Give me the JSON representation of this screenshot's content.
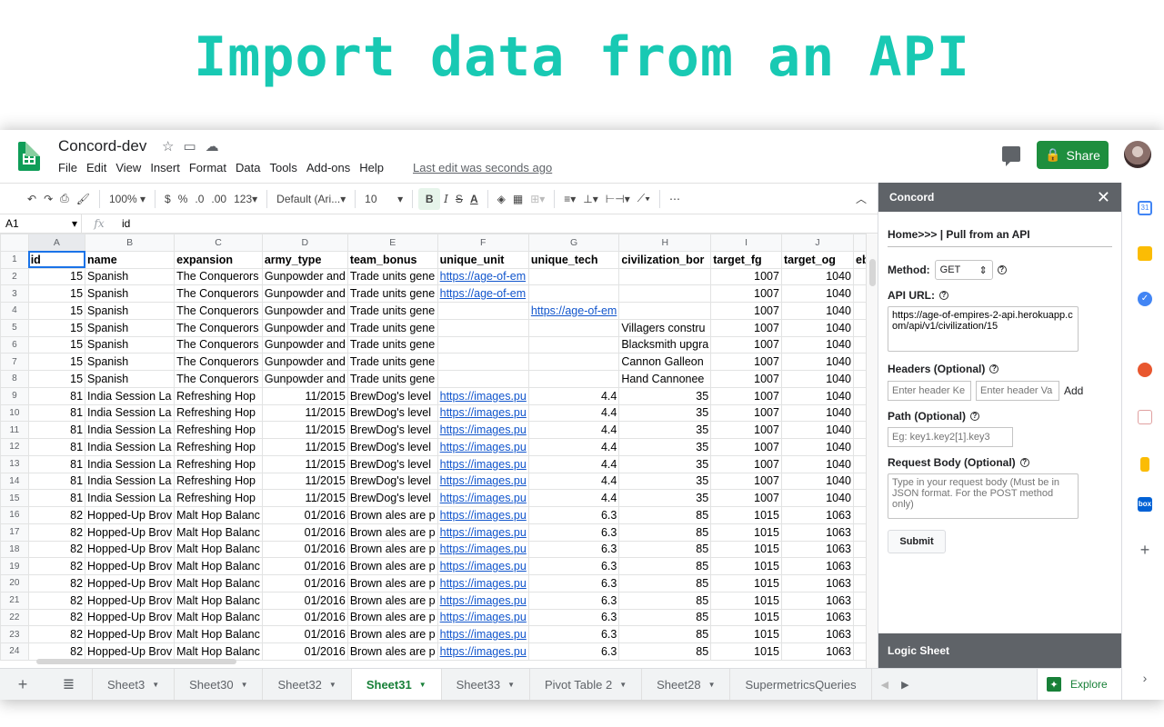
{
  "headline": "Import data from an API",
  "doc": {
    "title": "Concord-dev",
    "menu": [
      "File",
      "Edit",
      "View",
      "Insert",
      "Format",
      "Data",
      "Tools",
      "Add-ons",
      "Help"
    ],
    "last_edit": "Last edit was seconds ago",
    "share_label": "Share"
  },
  "toolbar": {
    "zoom": "100%",
    "currency": "$",
    "percent": "%",
    "dec_less": ".0",
    "dec_more": ".00",
    "more_formats": "123",
    "font": "Default (Ari...",
    "font_size": "10",
    "bold": "B",
    "italic": "I",
    "strike": "S",
    "text_color": "A"
  },
  "formula_bar": {
    "cell": "A1",
    "fx": "fx",
    "value": "id"
  },
  "grid": {
    "col_letters": [
      "A",
      "B",
      "C",
      "D",
      "E",
      "F",
      "G",
      "H",
      "I",
      "J",
      ""
    ],
    "row_numbers": [
      "1",
      "2",
      "3",
      "4",
      "5",
      "6",
      "7",
      "8",
      "9",
      "10",
      "11",
      "12",
      "13",
      "14",
      "15",
      "16",
      "17",
      "18",
      "19",
      "20",
      "21",
      "22",
      "23",
      "24"
    ],
    "header": [
      "id",
      "name",
      "expansion",
      "army_type",
      "team_bonus",
      "unique_unit",
      "unique_tech",
      "civilization_bor",
      "target_fg",
      "target_og",
      "eb"
    ],
    "rows": [
      [
        "15",
        "Spanish",
        "The Conquerors",
        "Gunpowder and",
        "Trade units gene",
        "https://age-of-em",
        "",
        "",
        "1007",
        "1040",
        ""
      ],
      [
        "15",
        "Spanish",
        "The Conquerors",
        "Gunpowder and",
        "Trade units gene",
        "https://age-of-em",
        "",
        "",
        "1007",
        "1040",
        ""
      ],
      [
        "15",
        "Spanish",
        "The Conquerors",
        "Gunpowder and",
        "Trade units gene",
        "",
        "https://age-of-em",
        "",
        "1007",
        "1040",
        ""
      ],
      [
        "15",
        "Spanish",
        "The Conquerors",
        "Gunpowder and",
        "Trade units gene",
        "",
        "",
        "Villagers constru",
        "1007",
        "1040",
        ""
      ],
      [
        "15",
        "Spanish",
        "The Conquerors",
        "Gunpowder and",
        "Trade units gene",
        "",
        "",
        "Blacksmith upgra",
        "1007",
        "1040",
        ""
      ],
      [
        "15",
        "Spanish",
        "The Conquerors",
        "Gunpowder and",
        "Trade units gene",
        "",
        "",
        "Cannon Galleon",
        "1007",
        "1040",
        ""
      ],
      [
        "15",
        "Spanish",
        "The Conquerors",
        "Gunpowder and",
        "Trade units gene",
        "",
        "",
        "Hand Cannonee",
        "1007",
        "1040",
        ""
      ],
      [
        "81",
        "India Session La",
        "Refreshing Hop",
        "11/2015",
        "BrewDog's level",
        "https://images.pu",
        "4.4",
        "35",
        "1007",
        "1040",
        ""
      ],
      [
        "81",
        "India Session La",
        "Refreshing Hop",
        "11/2015",
        "BrewDog's level",
        "https://images.pu",
        "4.4",
        "35",
        "1007",
        "1040",
        ""
      ],
      [
        "81",
        "India Session La",
        "Refreshing Hop",
        "11/2015",
        "BrewDog's level",
        "https://images.pu",
        "4.4",
        "35",
        "1007",
        "1040",
        ""
      ],
      [
        "81",
        "India Session La",
        "Refreshing Hop",
        "11/2015",
        "BrewDog's level",
        "https://images.pu",
        "4.4",
        "35",
        "1007",
        "1040",
        ""
      ],
      [
        "81",
        "India Session La",
        "Refreshing Hop",
        "11/2015",
        "BrewDog's level",
        "https://images.pu",
        "4.4",
        "35",
        "1007",
        "1040",
        ""
      ],
      [
        "81",
        "India Session La",
        "Refreshing Hop",
        "11/2015",
        "BrewDog's level",
        "https://images.pu",
        "4.4",
        "35",
        "1007",
        "1040",
        ""
      ],
      [
        "81",
        "India Session La",
        "Refreshing Hop",
        "11/2015",
        "BrewDog's level",
        "https://images.pu",
        "4.4",
        "35",
        "1007",
        "1040",
        ""
      ],
      [
        "82",
        "Hopped-Up Brov",
        "Malt Hop Balanc",
        "01/2016",
        "Brown ales are p",
        "https://images.pu",
        "6.3",
        "85",
        "1015",
        "1063",
        ""
      ],
      [
        "82",
        "Hopped-Up Brov",
        "Malt Hop Balanc",
        "01/2016",
        "Brown ales are p",
        "https://images.pu",
        "6.3",
        "85",
        "1015",
        "1063",
        ""
      ],
      [
        "82",
        "Hopped-Up Brov",
        "Malt Hop Balanc",
        "01/2016",
        "Brown ales are p",
        "https://images.pu",
        "6.3",
        "85",
        "1015",
        "1063",
        ""
      ],
      [
        "82",
        "Hopped-Up Brov",
        "Malt Hop Balanc",
        "01/2016",
        "Brown ales are p",
        "https://images.pu",
        "6.3",
        "85",
        "1015",
        "1063",
        ""
      ],
      [
        "82",
        "Hopped-Up Brov",
        "Malt Hop Balanc",
        "01/2016",
        "Brown ales are p",
        "https://images.pu",
        "6.3",
        "85",
        "1015",
        "1063",
        ""
      ],
      [
        "82",
        "Hopped-Up Brov",
        "Malt Hop Balanc",
        "01/2016",
        "Brown ales are p",
        "https://images.pu",
        "6.3",
        "85",
        "1015",
        "1063",
        ""
      ],
      [
        "82",
        "Hopped-Up Brov",
        "Malt Hop Balanc",
        "01/2016",
        "Brown ales are p",
        "https://images.pu",
        "6.3",
        "85",
        "1015",
        "1063",
        ""
      ],
      [
        "82",
        "Hopped-Up Brov",
        "Malt Hop Balanc",
        "01/2016",
        "Brown ales are p",
        "https://images.pu",
        "6.3",
        "85",
        "1015",
        "1063",
        ""
      ],
      [
        "82",
        "Hopped-Up Brov",
        "Malt Hop Balanc",
        "01/2016",
        "Brown ales are p",
        "https://images.pu",
        "6.3",
        "85",
        "1015",
        "1063",
        ""
      ]
    ]
  },
  "sheet_tabs": {
    "tabs": [
      "Sheet3",
      "Sheet30",
      "Sheet32",
      "Sheet31",
      "Sheet33",
      "Pivot Table 2",
      "Sheet28",
      "SupermetricsQueries"
    ],
    "active": "Sheet31",
    "explore_label": "Explore"
  },
  "panel": {
    "title": "Concord",
    "breadcrumb": "Home>>> | Pull from an API",
    "method_label": "Method:",
    "method_value": "GET",
    "url_label": "API URL:",
    "url_value": "https://age-of-empires-2-api.herokuapp.com/api/v1/civilization/15",
    "headers_label": "Headers (Optional)",
    "header_key_placeholder": "Enter header Ke",
    "header_value_placeholder": "Enter header Va",
    "add_label": "Add",
    "path_label": "Path (Optional)",
    "path_placeholder": "Eg: key1.key2[1].key3",
    "body_label": "Request Body (Optional)",
    "body_placeholder": "Type in your request body (Must be in JSON format. For the POST method only)",
    "submit_label": "Submit",
    "footer": "Logic Sheet"
  },
  "rail_icons": [
    "calendar-icon",
    "keep-icon",
    "tasks-icon",
    "addon-icon-1",
    "addon-icon-2",
    "addon-icon-3",
    "box-icon",
    "add-addon-icon"
  ],
  "colors": {
    "headline": "#18c9b3",
    "share": "#1e8e3e",
    "active_tab": "#188038",
    "link": "#1155cc",
    "panel_header": "#5f6368"
  }
}
